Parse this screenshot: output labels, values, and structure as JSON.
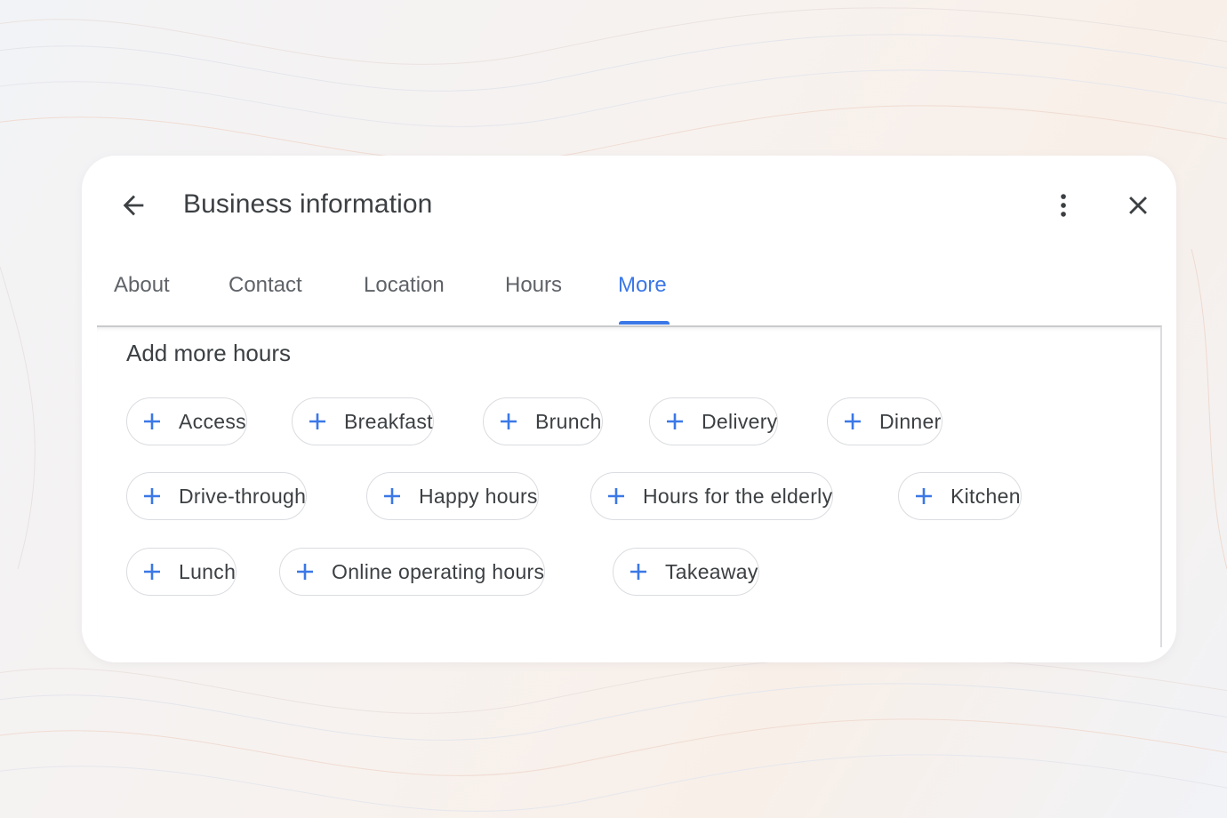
{
  "dialog": {
    "title": "Business information"
  },
  "tabs": [
    {
      "label": "About",
      "active": false
    },
    {
      "label": "Contact",
      "active": false
    },
    {
      "label": "Location",
      "active": false
    },
    {
      "label": "Hours",
      "active": false
    },
    {
      "label": "More",
      "active": true
    }
  ],
  "section": {
    "title": "Add more hours"
  },
  "chips": [
    {
      "label": "Access"
    },
    {
      "label": "Breakfast"
    },
    {
      "label": "Brunch"
    },
    {
      "label": "Delivery"
    },
    {
      "label": "Dinner"
    },
    {
      "label": "Drive-through"
    },
    {
      "label": "Happy hours"
    },
    {
      "label": "Hours for the elderly"
    },
    {
      "label": "Kitchen"
    },
    {
      "label": "Lunch"
    },
    {
      "label": "Online operating hours"
    },
    {
      "label": "Takeaway"
    }
  ],
  "icons": {
    "back": "arrow-back-icon",
    "menu": "more-vert-icon",
    "close": "close-icon",
    "add": "plus-icon"
  },
  "colors": {
    "accent": "#3b78e7",
    "text": "#3c4043",
    "muted": "#5f6368",
    "chip_border": "#dadce0"
  }
}
